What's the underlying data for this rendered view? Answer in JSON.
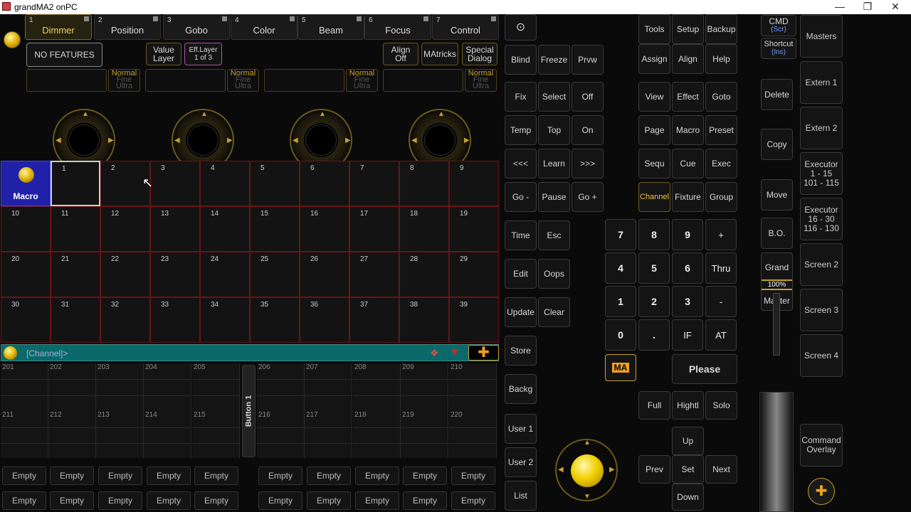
{
  "window": {
    "title": "grandMA2 onPC",
    "minimize": "—",
    "restore": "❐",
    "close": "✕"
  },
  "preset_tabs": [
    {
      "num": "1",
      "label": "Dimmer"
    },
    {
      "num": "2",
      "label": "Position"
    },
    {
      "num": "3",
      "label": "Gobo"
    },
    {
      "num": "4",
      "label": "Color"
    },
    {
      "num": "5",
      "label": "Beam"
    },
    {
      "num": "6",
      "label": "Focus"
    },
    {
      "num": "7",
      "label": "Control"
    }
  ],
  "features": {
    "no_features": "NO FEATURES",
    "value_layer": "Value\nLayer",
    "eff_layer": "Eff.Layer",
    "eff_layer_sub": "1 of 3",
    "align": "Align\nOff",
    "matricks": "MAtricks",
    "special_dialog": "Special\nDialog"
  },
  "encoders": {
    "mode_normal": "Normal",
    "mode_fine": "Fine",
    "mode_ultra": "Ultra"
  },
  "pool": {
    "macro_label": "Macro",
    "cells": [
      "1",
      "2",
      "3",
      "4",
      "5",
      "6",
      "7",
      "8",
      "9",
      "10",
      "11",
      "12",
      "13",
      "14",
      "15",
      "16",
      "17",
      "18",
      "19",
      "20",
      "21",
      "22",
      "23",
      "24",
      "25",
      "26",
      "27",
      "28",
      "29",
      "30",
      "31",
      "32",
      "33",
      "34",
      "35",
      "36",
      "37",
      "38",
      "39"
    ]
  },
  "command_line": {
    "text": "[Channel]>"
  },
  "faders": {
    "top": [
      "201",
      "202",
      "203",
      "204",
      "205",
      "206",
      "207",
      "208",
      "209",
      "210"
    ],
    "bottom": [
      "211",
      "212",
      "213",
      "214",
      "215",
      "216",
      "217",
      "218",
      "219",
      "220"
    ],
    "button": "Button 1"
  },
  "empty_label": "Empty",
  "col1": [
    "Blind",
    "Freeze",
    "Prvw",
    "Fix",
    "Select",
    "Off",
    "Temp",
    "Top",
    "On",
    "<<<",
    "Learn",
    ">>>",
    "Go -",
    "Pause",
    "Go +",
    "Time",
    "Esc",
    "Edit",
    "Oops",
    "Update",
    "Clear",
    "Store",
    "Backg",
    "User 1",
    "User 2",
    "List"
  ],
  "col2": [
    "Tools",
    "Setup",
    "Backup",
    "Assign",
    "Align",
    "Help",
    "View",
    "Effect",
    "Goto",
    "Page",
    "Macro",
    "Preset",
    "Sequ",
    "Cue",
    "Exec",
    "Channel",
    "Fixture",
    "Group"
  ],
  "keypad": [
    "7",
    "8",
    "9",
    "+",
    "4",
    "5",
    "6",
    "Thru",
    "1",
    "2",
    "3",
    "-",
    "0",
    ".",
    "IF",
    "AT"
  ],
  "ma_label": "MA",
  "please": "Please",
  "bottom_keys": [
    "Full",
    "Hightl",
    "Solo",
    "Up",
    "Prev",
    "Set",
    "Next",
    "Down"
  ],
  "cmd": {
    "cmd": "CMD",
    "cmd_sub": "(Scr)",
    "shortcut": "Shortcut",
    "shortcut_sub": "(Ins)",
    "delete": "Delete",
    "copy": "Copy",
    "move": "Move",
    "bo": "B.O.",
    "grand": "Grand",
    "pct": "100%",
    "master": "Master"
  },
  "right": [
    "Masters",
    "Extern 1",
    "Extern 2",
    "Executor\n1 - 15\n101 - 115",
    "Executor\n16 - 30\n116 - 130",
    "Screen 2",
    "Screen 3",
    "Screen 4",
    "Command\nOverlay"
  ]
}
